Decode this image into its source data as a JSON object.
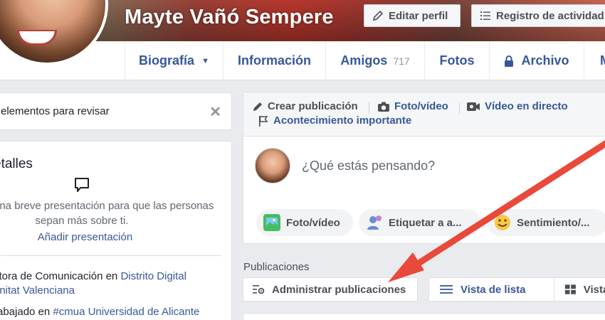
{
  "profile": {
    "name": "Mayte Vañó Sempere"
  },
  "cover_buttons": {
    "edit_label": "Editar perfil",
    "activity_label": "Registro de actividad"
  },
  "tabs": {
    "biography": "Biografía",
    "information": "Información",
    "friends": "Amigos",
    "friends_count": "717",
    "photos": "Fotos",
    "archive": "Archivo",
    "more": "M"
  },
  "review": {
    "text": "elementos para revisar"
  },
  "details": {
    "title": "etalles",
    "presentation_line1": "una breve presentación para que las personas",
    "presentation_line2": "sepan más sobre ti.",
    "add_presentation": "Añadir presentación",
    "work1_prefix": "ctora de Comunicación en ",
    "work1_link": "Distrito Digital",
    "work1_line2": "unitat Valenciana",
    "work2_prefix": "rabajado en ",
    "work2_link": "#cmua Universidad de Alicante"
  },
  "composer": {
    "create_post": "Crear publicación",
    "photo_video": "Foto/vídeo",
    "live_video": "Vídeo en directo",
    "life_event": "Acontecimiento importante",
    "placeholder": "¿Qué estás pensando?",
    "pill_photo": "Foto/vídeo",
    "pill_tag": "Etiquetar a a...",
    "pill_feeling": "Sentimiento/..."
  },
  "posts": {
    "label": "Publicaciones",
    "manage": "Administrar publicaciones",
    "list_view": "Vista de lista",
    "grid_view": "Vista de"
  },
  "colors": {
    "link_blue": "#385898",
    "tab_blue": "#365899",
    "arrow_red": "#e8493b"
  }
}
